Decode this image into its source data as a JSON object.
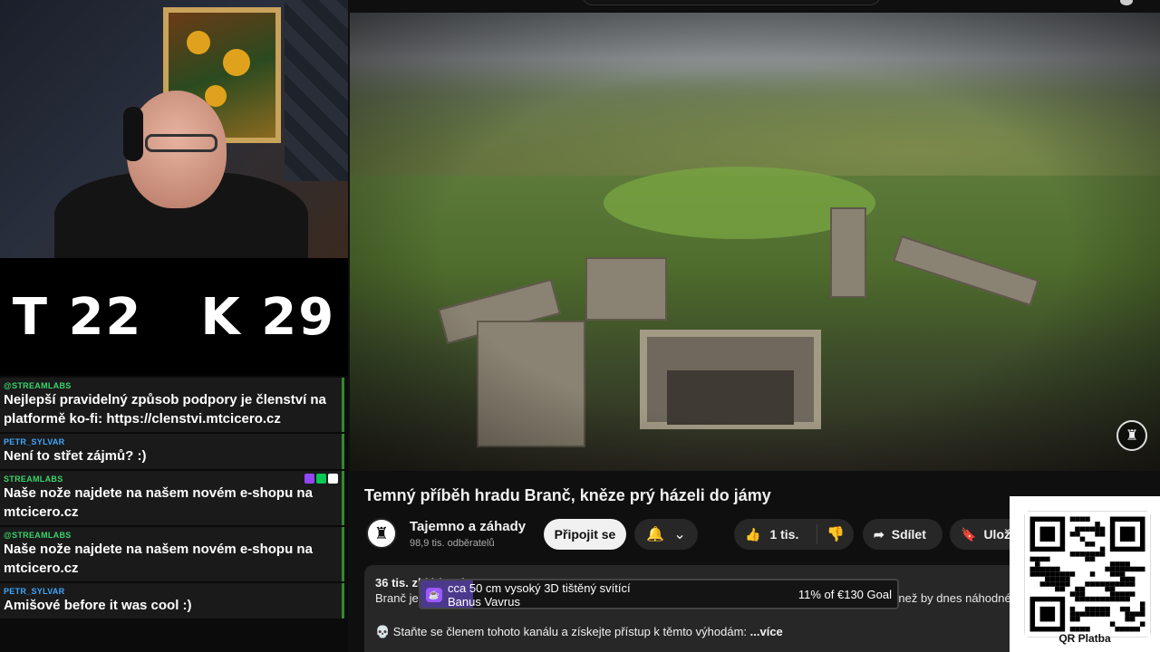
{
  "stream": {
    "score_t": "T 22",
    "score_k": "K 29"
  },
  "chat": [
    {
      "user": "@STREAMLABS",
      "text": "Nejlepší pravidelný způsob podpory je členství na platformě ko-fi: https://clenstvi.mtcicero.cz",
      "color": "green"
    },
    {
      "user": "PETR_SYLVAR",
      "text": "Není to střet zájmů? :)",
      "color": "blue"
    },
    {
      "user": "STREAMLABS",
      "text": "Naše nože najdete na našem novém e-shopu na mtcicero.cz",
      "color": "green"
    },
    {
      "user": "@STREAMLABS",
      "text": "Naše nože najdete na našem novém e-shopu na mtcicero.cz",
      "color": "green"
    },
    {
      "user": "PETR_SYLVAR",
      "text": "Amišové before it was cool :)",
      "color": "blue"
    }
  ],
  "video": {
    "title": "Temný příběh hradu Branč, kněze prý házeli do jámy",
    "channel": "Tajemno a záhady",
    "subscribers": "98,9 tis. odběratelů",
    "subscribe_label": "Připojit se",
    "likes": "1 tis.",
    "share_label": "Sdílet",
    "save_label": "Ulož",
    "desc_meta": "36 tis. zhlédnutí",
    "desc_line1": "Branč je zřícenina hradu nacházející se na samém západě Slovenska. Jeho historie je ale temnější, než by dnes náhodného",
    "desc_line2": "💀 Staňte se členem tohoto kanálu a získejte přístup k těmto výhodám:",
    "more_label": "...více"
  },
  "goal": {
    "title": "cca 50 cm vysoký 3D tištěný svítící",
    "name": "Banus Vavrus",
    "percent_text": "11% of €130 Goal",
    "progress": 0.11
  },
  "qr": {
    "label": "QR Platba"
  },
  "colors": {
    "accent_green": "#3bd46b",
    "accent_blue": "#3ea6ff",
    "goal_purple": "#4b3a8c"
  }
}
